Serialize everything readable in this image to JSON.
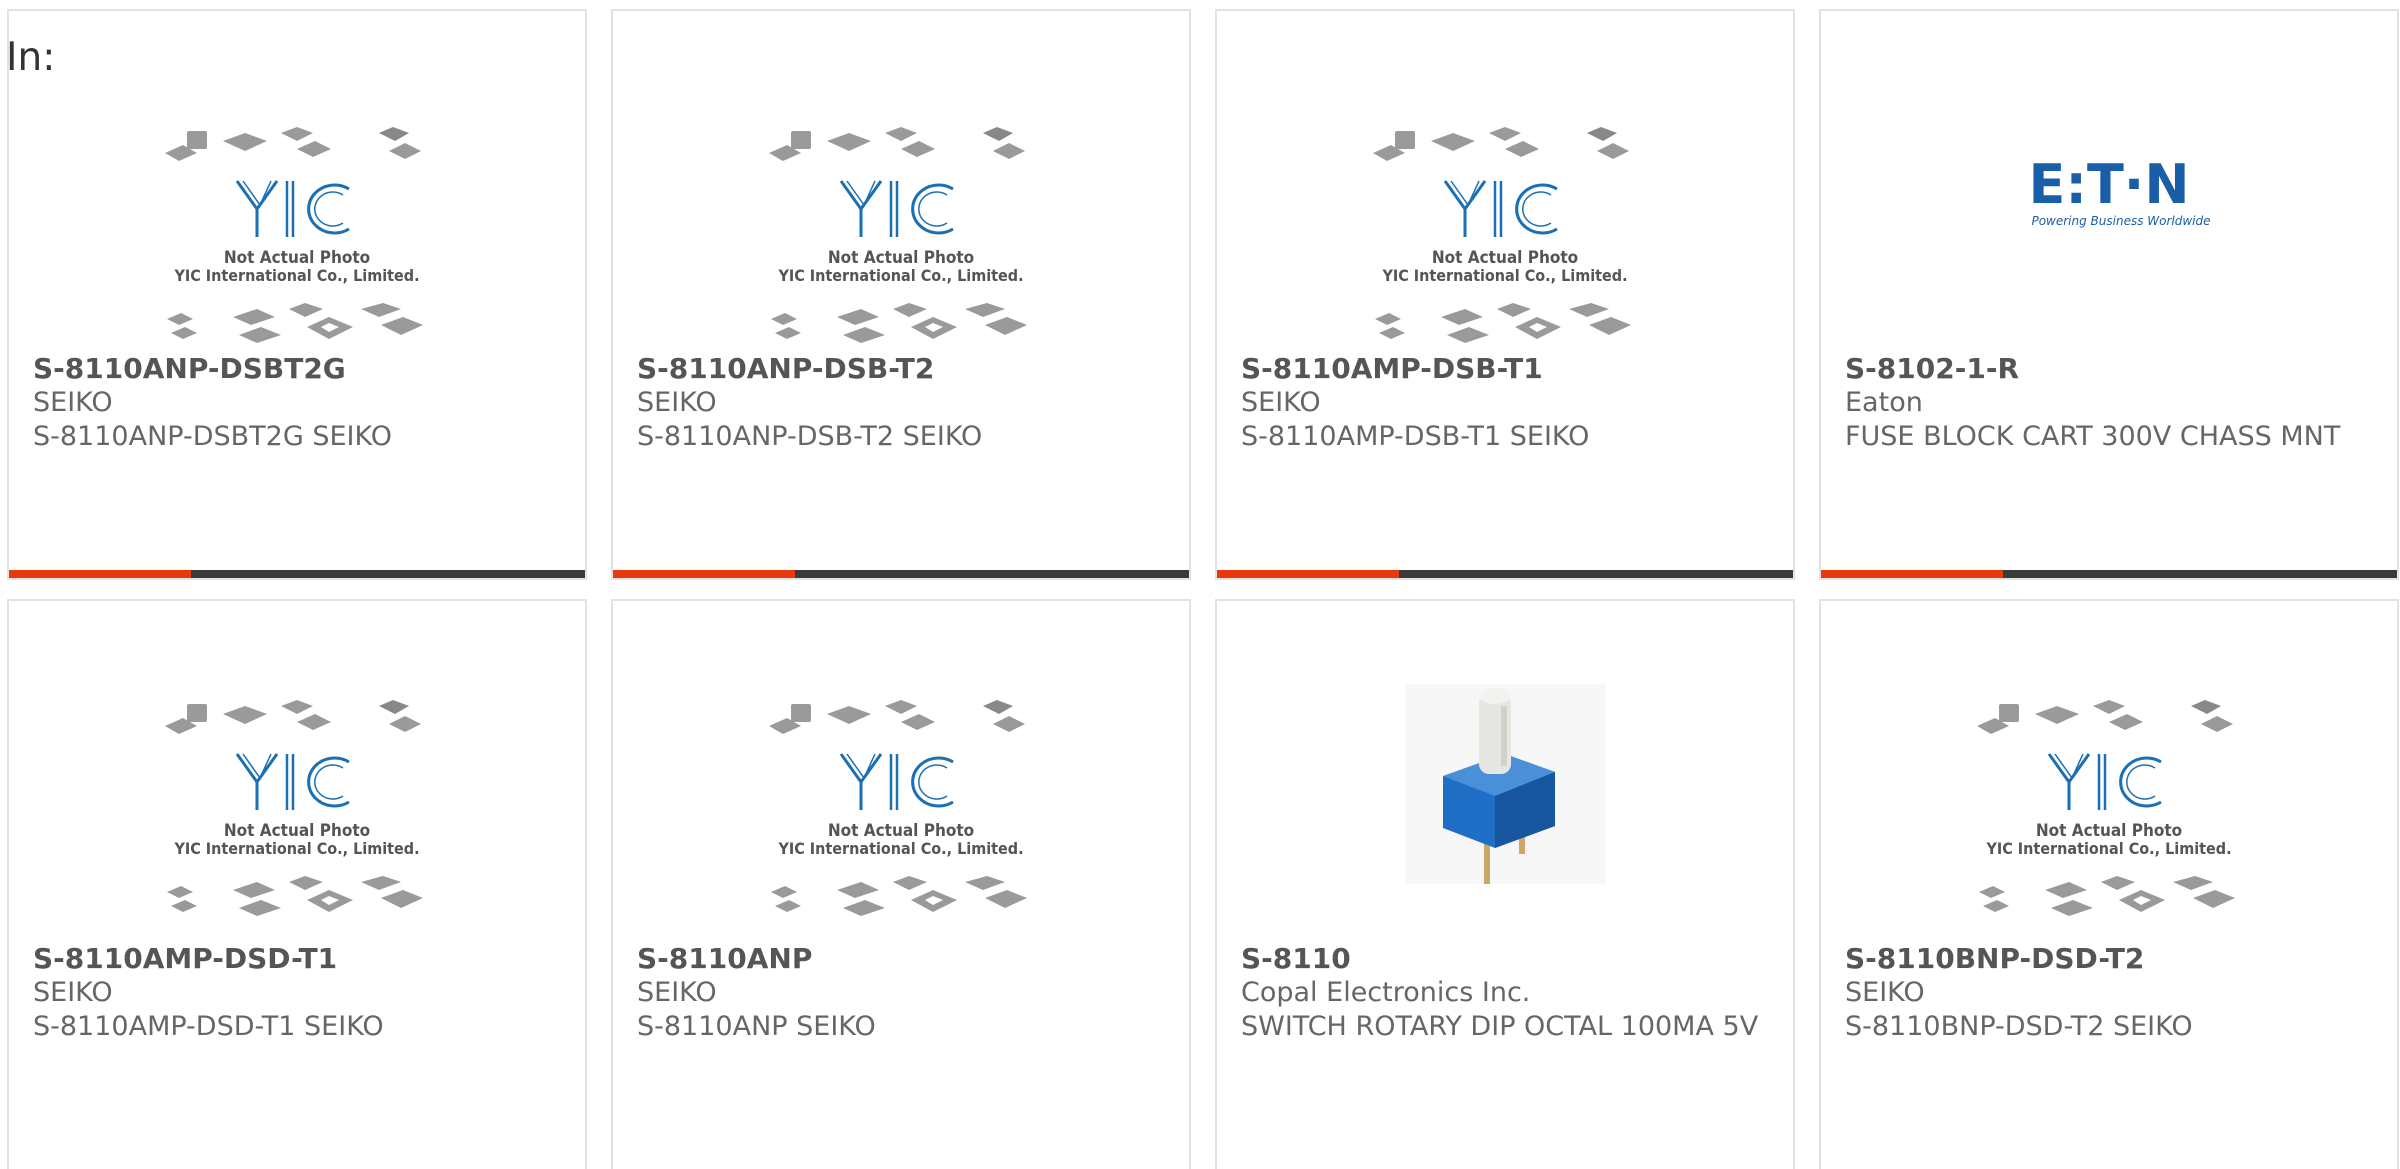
{
  "page": {
    "in_label": "In:"
  },
  "colors": {
    "accent": "#e8380d",
    "bar": "#3a3a3a",
    "eaton_blue": "#1a5ea8",
    "yic_blue": "#1b6fb3",
    "switch_blue": "#1f6fc6"
  },
  "placeholder_image": {
    "line1": "Not Actual Photo",
    "line2": "YIC International Co., Limited.",
    "logo_text": "YIC"
  },
  "eaton_logo": {
    "text": "E:T·N",
    "tagline": "Powering Business Worldwide"
  },
  "products": [
    {
      "part": "S-8110ANP-DSBT2G",
      "manufacturer": "SEIKO",
      "description": "S-8110ANP-DSBT2G SEIKO",
      "image": "yic-placeholder-icon"
    },
    {
      "part": "S-8110ANP-DSB-T2",
      "manufacturer": "SEIKO",
      "description": "S-8110ANP-DSB-T2 SEIKO",
      "image": "yic-placeholder-icon"
    },
    {
      "part": "S-8110AMP-DSB-T1",
      "manufacturer": "SEIKO",
      "description": "S-8110AMP-DSB-T1 SEIKO",
      "image": "yic-placeholder-icon"
    },
    {
      "part": "S-8102-1-R",
      "manufacturer": "Eaton",
      "description": "FUSE BLOCK CART 300V CHASS MNT",
      "image": "eaton-logo-icon"
    },
    {
      "part": "S-8110AMP-DSD-T1",
      "manufacturer": "SEIKO",
      "description": "S-8110AMP-DSD-T1 SEIKO",
      "image": "yic-placeholder-icon"
    },
    {
      "part": "S-8110ANP",
      "manufacturer": "SEIKO",
      "description": "S-8110ANP SEIKO",
      "image": "yic-placeholder-icon"
    },
    {
      "part": "S-8110",
      "manufacturer": "Copal Electronics Inc.",
      "description": "SWITCH ROTARY DIP OCTAL 100MA 5V",
      "image": "rotary-dip-switch-icon"
    },
    {
      "part": "S-8110BNP-DSD-T2",
      "manufacturer": "SEIKO",
      "description": "S-8110BNP-DSD-T2 SEIKO",
      "image": "yic-placeholder-icon"
    }
  ]
}
